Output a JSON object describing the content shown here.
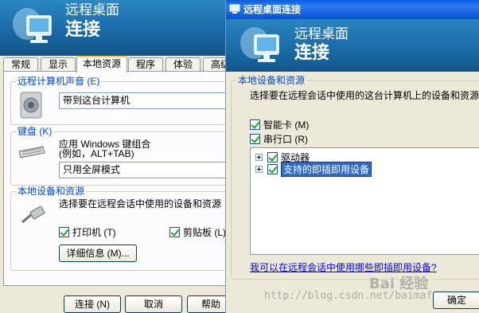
{
  "left": {
    "banner": {
      "line1": "远程桌面",
      "line2": "连接"
    },
    "tabs": [
      {
        "label": "常规"
      },
      {
        "label": "显示"
      },
      {
        "label": "本地资源"
      },
      {
        "label": "程序"
      },
      {
        "label": "体验"
      },
      {
        "label": "高级"
      }
    ],
    "sound": {
      "legend": "远程计算机声音 (E)",
      "value": "带到这台计算机"
    },
    "keyboard": {
      "legend": "键盘 (K)",
      "desc1": "应用 Windows 键组合",
      "desc2": "(例如，ALT+TAB)",
      "value": "只用全屏模式"
    },
    "devices": {
      "legend": "本地设备和资源",
      "desc": "选择要在远程会话中使用的设备和资源",
      "printer_label": "打印机 (T)",
      "clipboard_label": "剪贴板 (L)",
      "details_button": "详细信息 (M)..."
    },
    "buttons": {
      "connect": "连接 (N)",
      "cancel": "取消",
      "help": "帮助"
    }
  },
  "right": {
    "title": "远程桌面连接",
    "banner": {
      "line1": "远程桌面",
      "line2": "连接"
    },
    "legend": "本地设备和资源",
    "desc": "选择要在远程会话中使用的这台计算机上的设备和资源",
    "smartcard_label": "智能卡 (M)",
    "serial_label": "串行口 (R)",
    "tree": [
      {
        "label": "驱动器"
      },
      {
        "label": "支持的即插即用设备"
      }
    ],
    "link": "我可以在远程会话中使用哪些即插即用设备?",
    "ok_button": "确定",
    "watermark": "http://blog.csdn.net/baimafq",
    "watermark_logo": "Bai 经验"
  }
}
